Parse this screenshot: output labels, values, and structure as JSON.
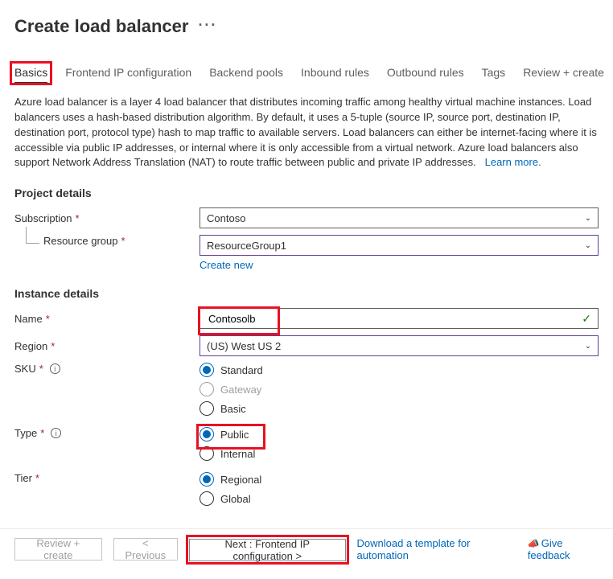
{
  "header": {
    "title": "Create load balancer"
  },
  "tabs": {
    "basics": "Basics",
    "frontend": "Frontend IP configuration",
    "backend": "Backend pools",
    "inbound": "Inbound rules",
    "outbound": "Outbound rules",
    "tags": "Tags",
    "review": "Review + create"
  },
  "description": "Azure load balancer is a layer 4 load balancer that distributes incoming traffic among healthy virtual machine instances. Load balancers uses a hash-based distribution algorithm. By default, it uses a 5-tuple (source IP, source port, destination IP, destination port, protocol type) hash to map traffic to available servers. Load balancers can either be internet-facing where it is accessible via public IP addresses, or internal where it is only accessible from a virtual network. Azure load balancers also support Network Address Translation (NAT) to route traffic between public and private IP addresses.",
  "learn_more": "Learn more.",
  "sections": {
    "project": "Project details",
    "instance": "Instance details"
  },
  "fields": {
    "subscription": {
      "label": "Subscription",
      "value": "Contoso"
    },
    "resource_group": {
      "label": "Resource group",
      "value": "ResourceGroup1",
      "create_new": "Create new"
    },
    "name": {
      "label": "Name",
      "value": "Contosolb"
    },
    "region": {
      "label": "Region",
      "value": "(US) West US 2"
    },
    "sku": {
      "label": "SKU",
      "options": {
        "standard": "Standard",
        "gateway": "Gateway",
        "basic": "Basic"
      }
    },
    "type": {
      "label": "Type",
      "options": {
        "public": "Public",
        "internal": "Internal"
      }
    },
    "tier": {
      "label": "Tier",
      "options": {
        "regional": "Regional",
        "global": "Global"
      }
    }
  },
  "footer": {
    "review": "Review + create",
    "previous": "< Previous",
    "next": "Next : Frontend IP configuration >",
    "download": "Download a template for automation",
    "feedback": "Give feedback"
  }
}
